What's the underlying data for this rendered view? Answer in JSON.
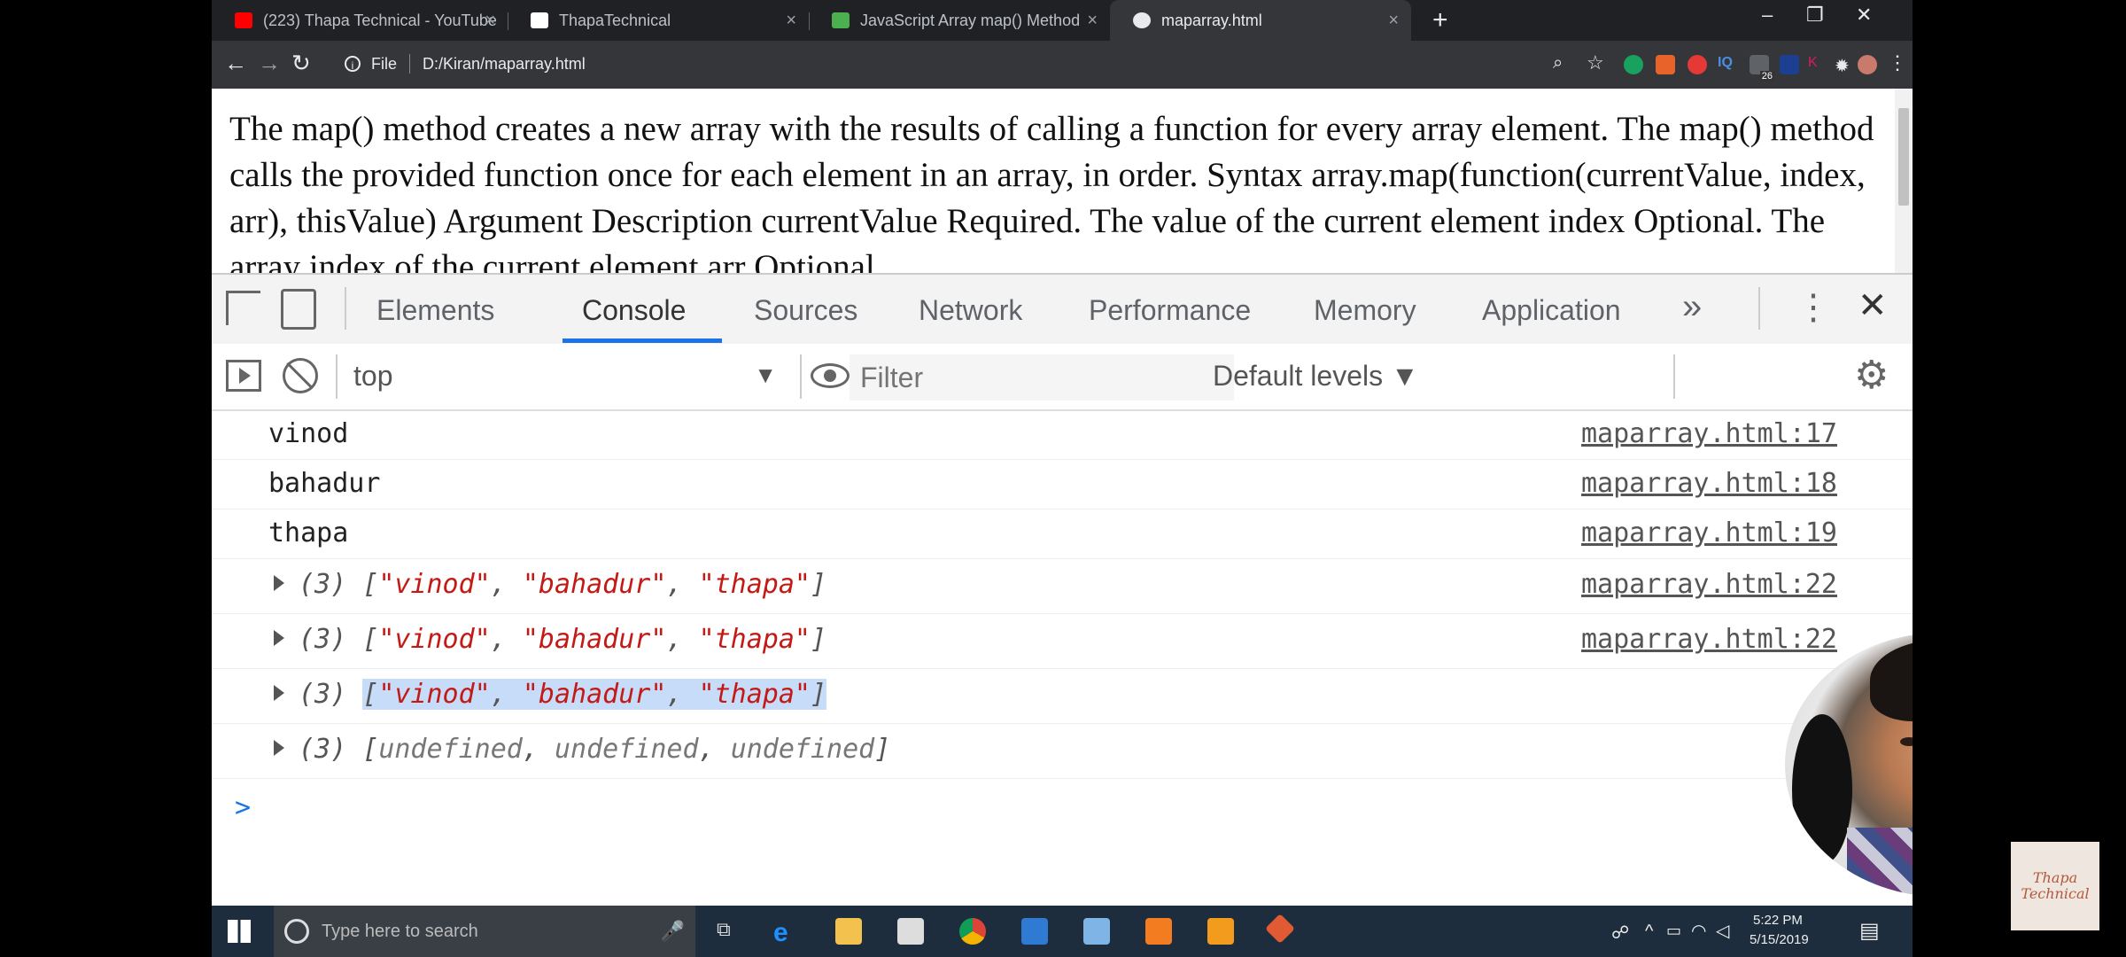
{
  "browser": {
    "tabs": [
      {
        "title": "(223) Thapa Technical - YouTube",
        "icon": "youtube-icon",
        "color": "#ff0000"
      },
      {
        "title": "ThapaTechnical",
        "icon": "page-icon",
        "color": "#ffffff"
      },
      {
        "title": "JavaScript Array map() Method",
        "icon": "w3schools-icon",
        "color": "#4caf50"
      },
      {
        "title": "maparray.html",
        "icon": "globe-icon",
        "color": "#e8eaed"
      }
    ],
    "new_tab": "+",
    "address": {
      "scheme": "File",
      "path": "D:/Kiran/maparray.html"
    },
    "extension_badge": "26"
  },
  "page": {
    "text": "The map() method creates a new array with the results of calling a function for every array element. The map() method calls the provided function once for each element in an array, in order. Syntax array.map(function(currentValue, index, arr), thisValue) Argument Description currentValue Required. The value of the current element index Optional. The array index of the current element arr Optional."
  },
  "devtools": {
    "tabs": [
      "Elements",
      "Console",
      "Sources",
      "Network",
      "Performance",
      "Memory",
      "Application"
    ],
    "more": "»",
    "context": "top",
    "filter_placeholder": "Filter",
    "levels": "Default levels ▼",
    "console": {
      "plain": [
        {
          "text": "vinod",
          "src": "maparray.html:17"
        },
        {
          "text": "bahadur",
          "src": "maparray.html:18"
        },
        {
          "text": "thapa",
          "src": "maparray.html:19"
        }
      ],
      "arrays": [
        {
          "count": "(3)",
          "items": [
            "\"vinod\"",
            "\"bahadur\"",
            "\"thapa\""
          ],
          "src": "maparray.html:22"
        },
        {
          "count": "(3)",
          "items": [
            "\"vinod\"",
            "\"bahadur\"",
            "\"thapa\""
          ],
          "src": "maparray.html:22"
        },
        {
          "count": "(3)",
          "items": [
            "\"vinod\"",
            "\"bahadur\"",
            "\"thapa\""
          ],
          "src": ""
        },
        {
          "count": "(3)",
          "items": [
            "undefined",
            "undefined",
            "undefined"
          ],
          "src": ""
        }
      ],
      "prompt": ">"
    }
  },
  "taskbar": {
    "search_placeholder": "Type here to search",
    "time": "5:22 PM",
    "date": "5/15/2019"
  },
  "watermark": "Thapa Technical"
}
